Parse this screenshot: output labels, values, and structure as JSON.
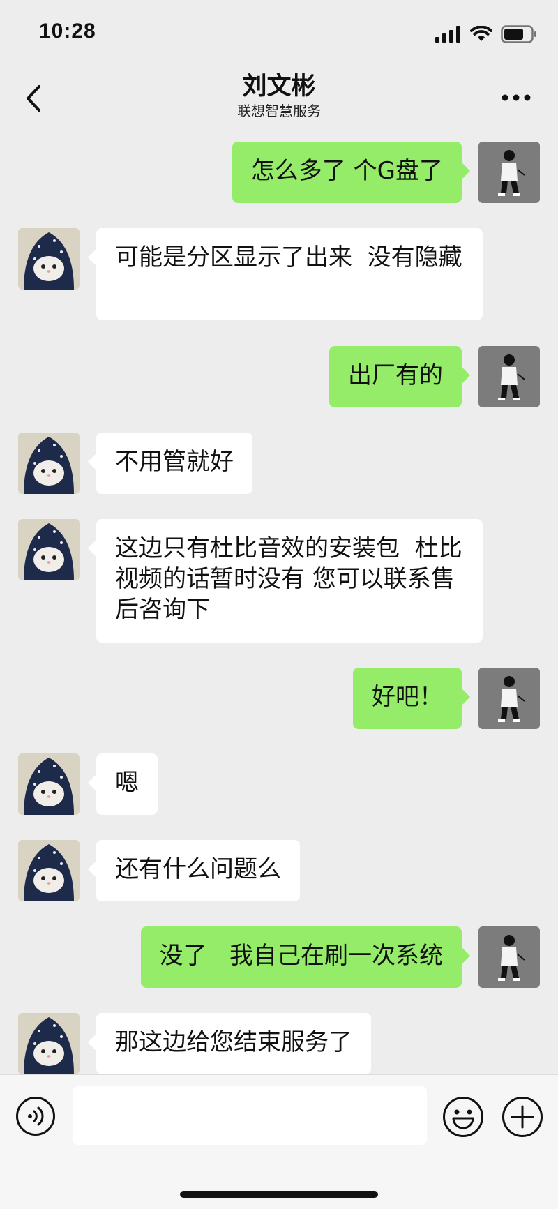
{
  "status_bar": {
    "time": "10:28"
  },
  "header": {
    "title": "刘文彬",
    "subtitle": "联想智慧服务"
  },
  "messages": [
    {
      "side": "out",
      "text": "怎么多了 个G盘了"
    },
    {
      "side": "in",
      "text": "可能是分区显示了出来  没有隐藏"
    },
    {
      "side": "out",
      "text": "出厂有的"
    },
    {
      "side": "in",
      "text": "不用管就好"
    },
    {
      "side": "in",
      "text": "这边只有杜比音效的安装包  杜比视频的话暂时没有 您可以联系售后咨询下"
    },
    {
      "side": "out",
      "text": "好吧！"
    },
    {
      "side": "in",
      "text": "嗯"
    },
    {
      "side": "in",
      "text": "还有什么问题么"
    },
    {
      "side": "out",
      "text": "没了   我自己在刷一次系统"
    },
    {
      "side": "in",
      "text": "那这边给您结束服务了"
    }
  ],
  "input_bar": {
    "text_value": ""
  },
  "colors": {
    "background": "#ededed",
    "out_bubble": "#95ec69",
    "in_bubble": "#ffffff"
  },
  "icons": [
    "signal-icon",
    "wifi-icon",
    "battery-icon",
    "back-icon",
    "more-icon",
    "voice-icon",
    "emoji-icon",
    "plus-icon"
  ]
}
